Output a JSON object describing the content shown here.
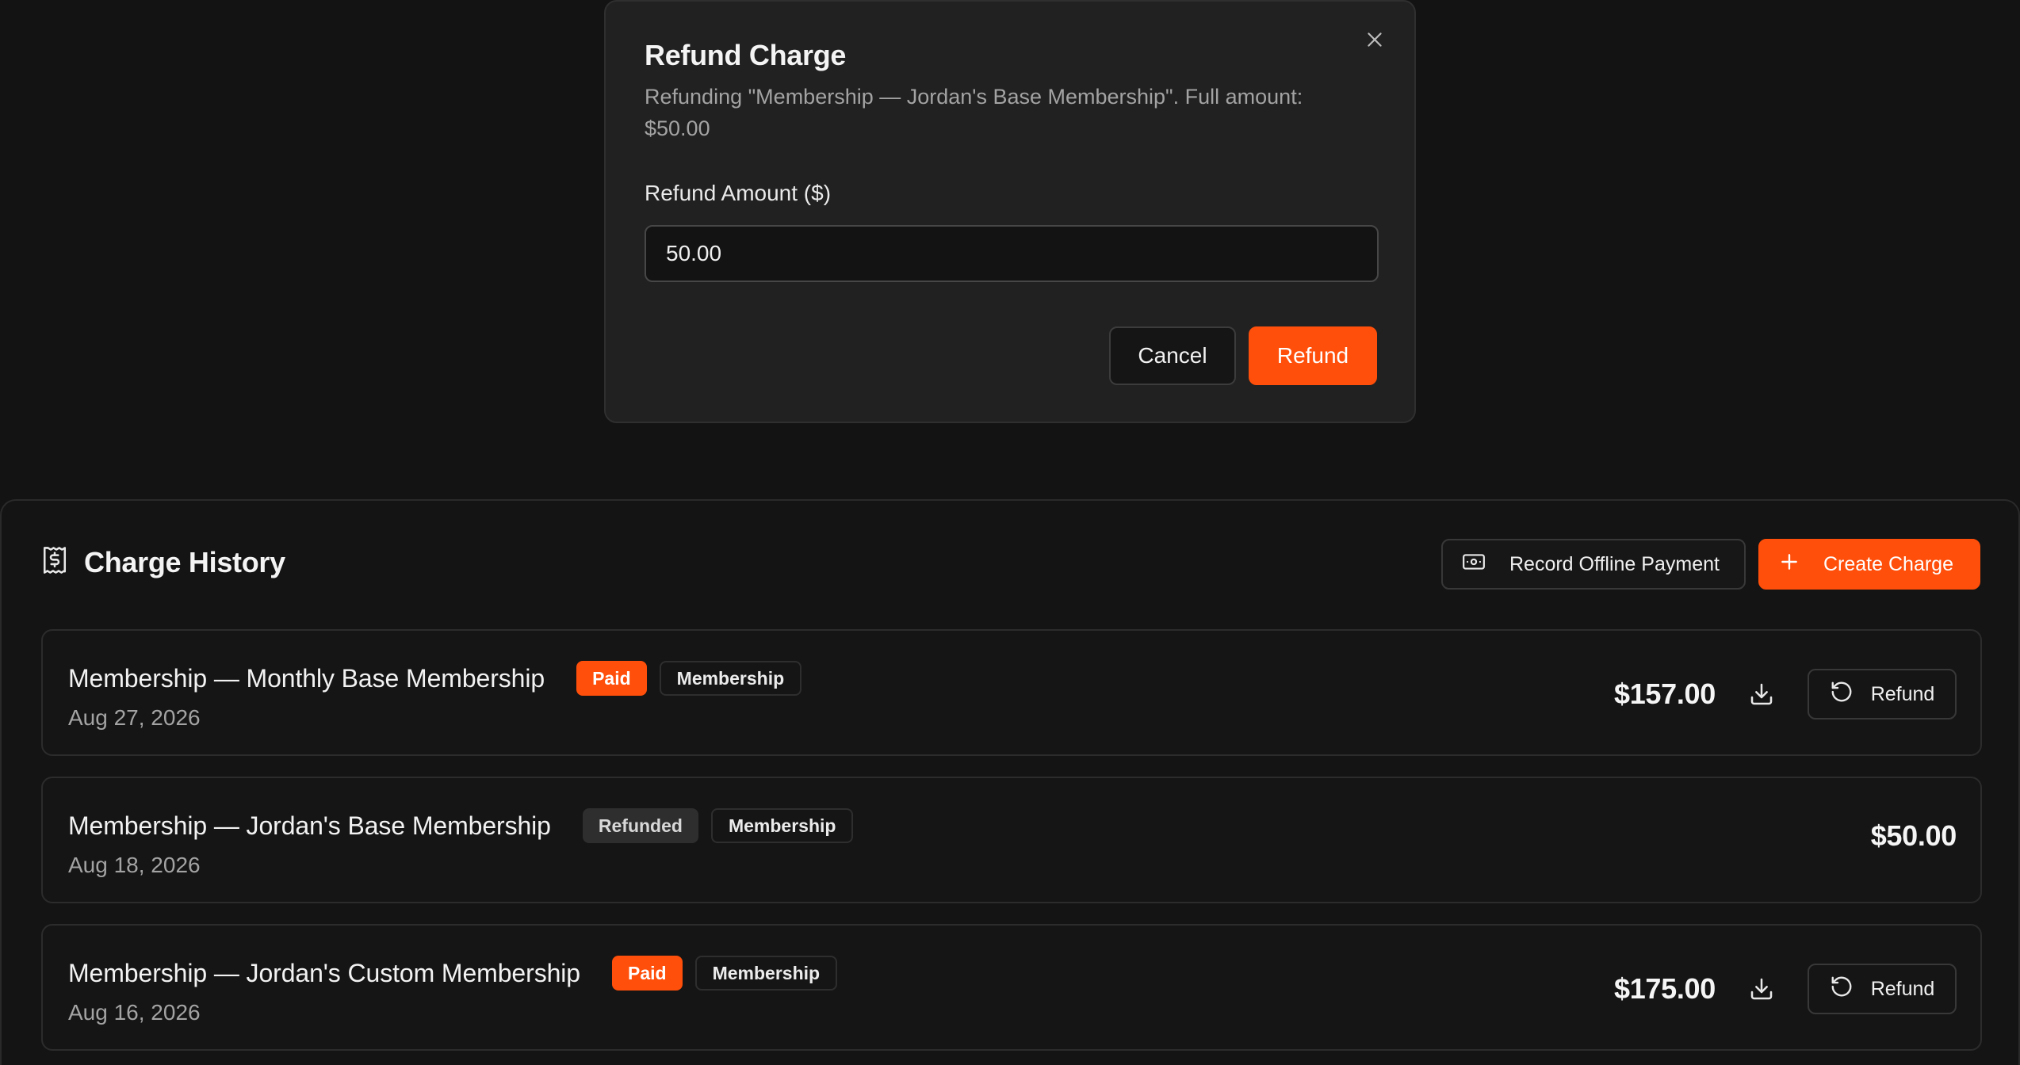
{
  "modal": {
    "title": "Refund Charge",
    "description": "Refunding \"Membership — Jordan's Base Membership\". Full amount: $50.00",
    "field_label": "Refund Amount ($)",
    "field_value": "50.00",
    "cancel_label": "Cancel",
    "refund_label": "Refund",
    "close_icon": "close-icon"
  },
  "panel": {
    "title": "Charge History",
    "title_icon": "receipt-dollar-icon",
    "record_offline_label": "Record Offline Payment",
    "create_charge_label": "Create Charge"
  },
  "charges": [
    {
      "title": "Membership — Monthly Base Membership",
      "status": "Paid",
      "type": "Membership",
      "date": "Aug 27, 2026",
      "amount": "$157.00",
      "refund_label": "Refund"
    },
    {
      "title": "Membership — Jordan's Base Membership",
      "status": "Refunded",
      "type": "Membership",
      "date": "Aug 18, 2026",
      "amount": "$50.00"
    },
    {
      "title": "Membership — Jordan's Custom Membership",
      "status": "Paid",
      "type": "Membership",
      "date": "Aug 16, 2026",
      "amount": "$175.00",
      "refund_label": "Refund"
    }
  ],
  "colors": {
    "accent": "#ff4f0a",
    "background": "#131313",
    "modal_background": "#212121"
  }
}
